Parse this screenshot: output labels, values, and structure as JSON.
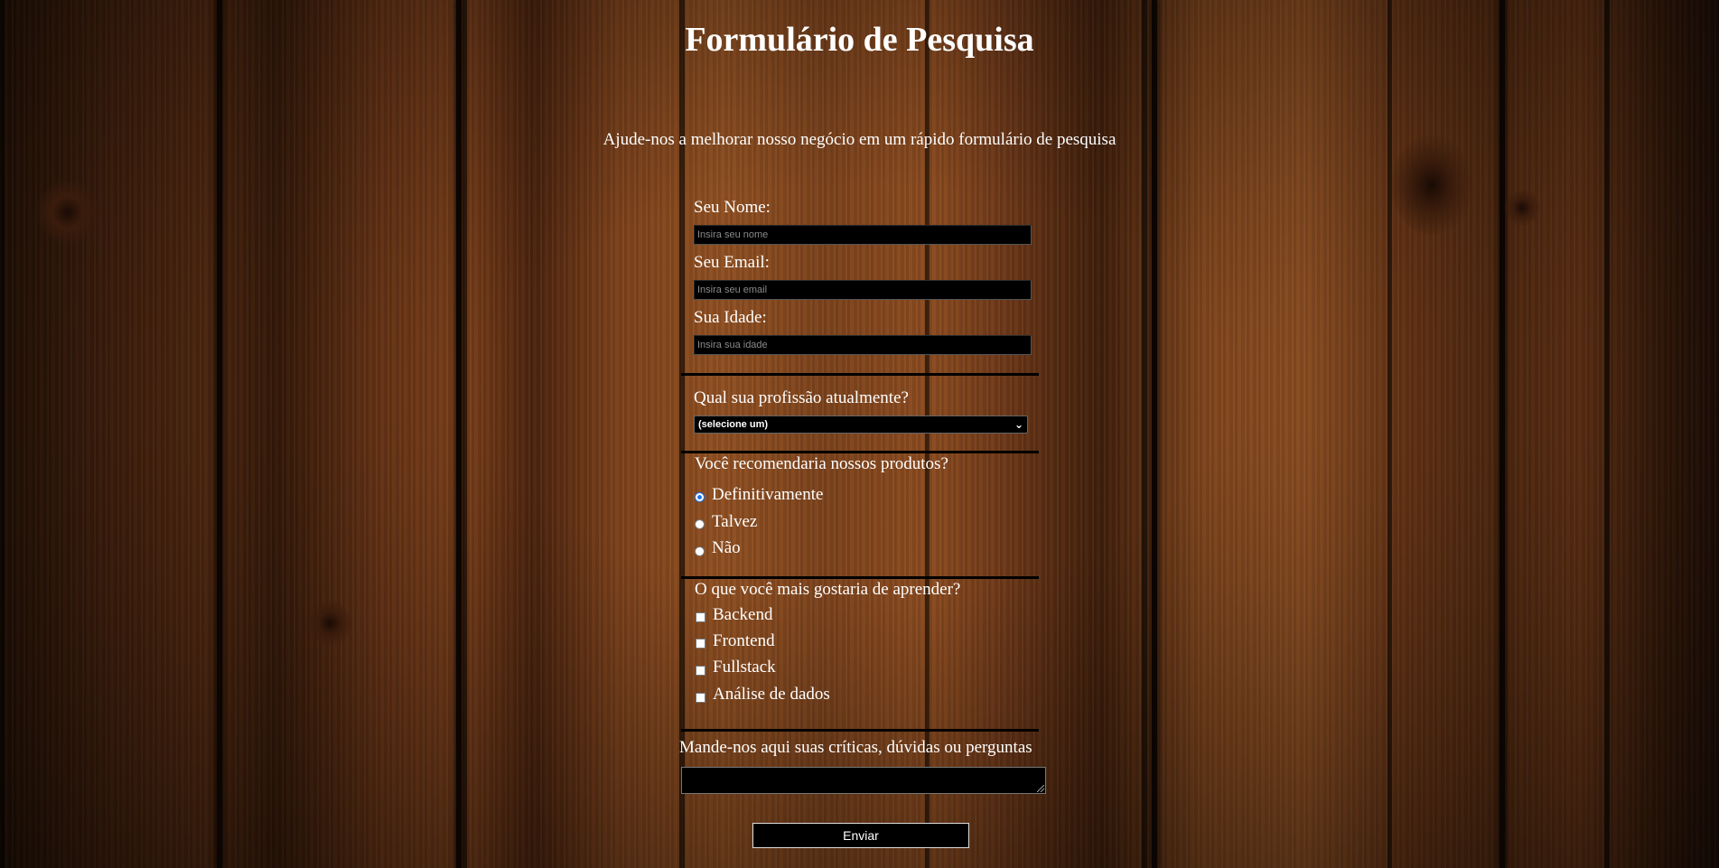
{
  "page": {
    "title": "Formulário de Pesquisa",
    "description": "Ajude-nos a melhorar nosso negócio em um rápido formulário de pesquisa"
  },
  "form": {
    "name": {
      "label": "Seu Nome:",
      "placeholder": "Insira seu nome",
      "value": ""
    },
    "email": {
      "label": "Seu Email:",
      "placeholder": "Insira seu email",
      "value": ""
    },
    "age": {
      "label": "Sua Idade:",
      "placeholder": "Insira sua idade",
      "value": ""
    },
    "profession": {
      "label": "Qual sua profissão atualmente?",
      "selected": "(selecione um)"
    },
    "recommend": {
      "label": "Você recomendaria nossos produtos?",
      "options": [
        {
          "label": "Definitivamente",
          "checked": true
        },
        {
          "label": "Talvez",
          "checked": false
        },
        {
          "label": "Não",
          "checked": false
        }
      ]
    },
    "learn": {
      "label": "O que você mais gostaria de aprender?",
      "options": [
        {
          "label": "Backend",
          "checked": false
        },
        {
          "label": "Frontend",
          "checked": false
        },
        {
          "label": "Fullstack",
          "checked": false
        },
        {
          "label": "Análise de dados",
          "checked": false
        }
      ]
    },
    "comments": {
      "label": "Mande-nos aqui suas críticas, dúvidas ou perguntas",
      "value": ""
    },
    "submit_label": "Enviar"
  },
  "icons": {
    "select_chevron": "chevron-down-icon"
  },
  "colors": {
    "field_background": "#000000",
    "text": "#ffffff",
    "radio_checked": "#1a73e8"
  }
}
